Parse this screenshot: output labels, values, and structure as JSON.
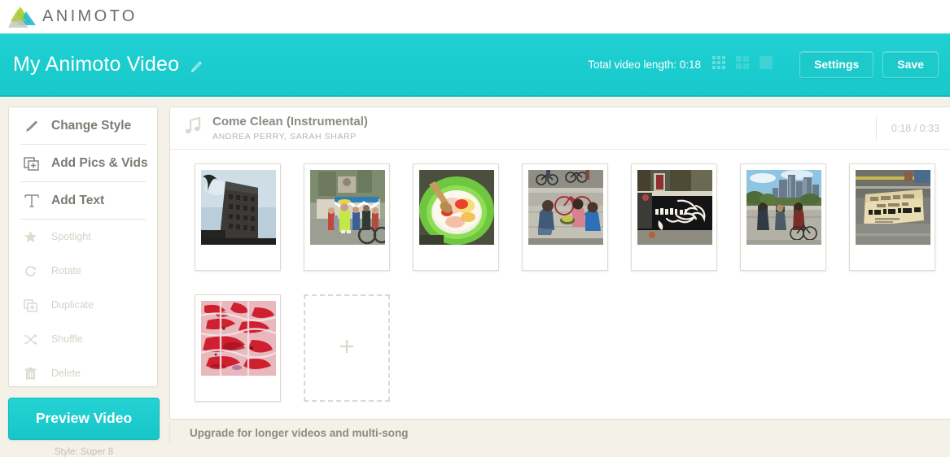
{
  "brand": {
    "name": "ANIMOTO",
    "logo_icon": "animoto-triangle-logo",
    "colors": {
      "green": "#b5d334",
      "teal": "#27bcd4",
      "gray": "#c9c7bd"
    }
  },
  "header": {
    "project_title": "My Animoto Video",
    "edit_icon": "pencil-icon",
    "video_length_label": "Total video length: 0:18",
    "view_modes": [
      {
        "name": "grid-3x3-view",
        "active": true
      },
      {
        "name": "grid-2x2-view",
        "active": false
      },
      {
        "name": "single-large-view",
        "active": false
      }
    ],
    "settings_label": "Settings",
    "save_label": "Save",
    "accent_color": "#1ecfd1"
  },
  "sidebar": {
    "primary_items": [
      {
        "label": "Change Style",
        "icon": "brush-icon"
      },
      {
        "label": "Add Pics & Vids",
        "icon": "add-media-icon"
      },
      {
        "label": "Add Text",
        "icon": "text-t-icon"
      }
    ],
    "disabled_items": [
      {
        "label": "Spotlight",
        "icon": "star-icon"
      },
      {
        "label": "Rotate",
        "icon": "rotate-icon"
      },
      {
        "label": "Duplicate",
        "icon": "duplicate-icon"
      },
      {
        "label": "Shuffle",
        "icon": "shuffle-icon"
      },
      {
        "label": "Delete",
        "icon": "trash-icon"
      }
    ],
    "preview_label": "Preview Video",
    "style_note": "Style: Super 8"
  },
  "song": {
    "icon": "music-note-icon",
    "title": "Come Clean (Instrumental)",
    "artist": "ANDREA PERRY, SARAH SHARP",
    "time": "0:18 / 0:33"
  },
  "storyboard": {
    "add_tile_icon": "plus-icon",
    "tiles": [
      {
        "name": "thumb-office-tower",
        "alt": "Tall dark office tower with palm tree"
      },
      {
        "name": "thumb-street-vendor",
        "alt": "Crowd around a street food cart with awning"
      },
      {
        "name": "thumb-shaved-ice",
        "alt": "Shaved ice dessert in a green bowl with spoon"
      },
      {
        "name": "thumb-cyclists-resting",
        "alt": "People sitting on pavement beside bicycles"
      },
      {
        "name": "thumb-graffiti-mural",
        "alt": "Dark wall with white swirl graffiti mural"
      },
      {
        "name": "thumb-city-skyline",
        "alt": "Downtown skyline with cyclists in foreground"
      },
      {
        "name": "thumb-street-sign",
        "alt": "Cardboard sign reading I WISH THIS STREET WAS"
      },
      {
        "name": "thumb-red-abstract",
        "alt": "Red and white abstract close-up texture"
      }
    ]
  },
  "footer": {
    "upgrade_text": "Upgrade for longer videos and multi-song"
  }
}
